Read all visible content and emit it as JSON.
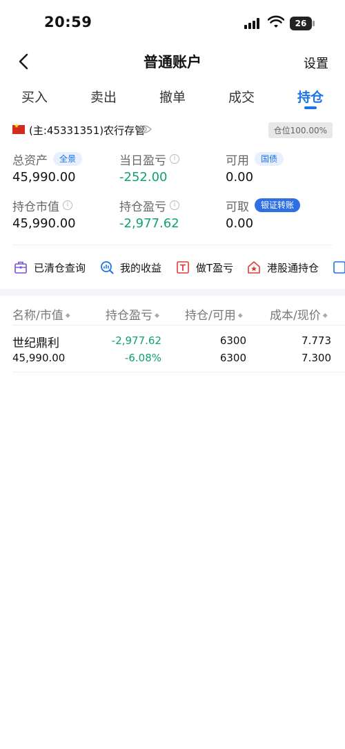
{
  "status_bar": {
    "time": "20:59",
    "battery": "26"
  },
  "nav": {
    "title": "普通账户",
    "settings": "设置"
  },
  "tabs": [
    {
      "label": "买入"
    },
    {
      "label": "卖出"
    },
    {
      "label": "撤单"
    },
    {
      "label": "成交"
    },
    {
      "label": "持仓",
      "active": true
    }
  ],
  "account": {
    "label": "(主:45331351)农行存管",
    "position_badge": "仓位100.00%"
  },
  "stats": {
    "total_assets": {
      "label": "总资产",
      "tag": "全景",
      "value": "45,990.00"
    },
    "daily_pnl": {
      "label": "当日盈亏",
      "value": "-252.00"
    },
    "available": {
      "label": "可用",
      "tag": "国债",
      "value": "0.00"
    },
    "market_value": {
      "label": "持仓市值",
      "value": "45,990.00"
    },
    "position_pnl": {
      "label": "持仓盈亏",
      "value": "-2,977.62"
    },
    "withdrawable": {
      "label": "可取",
      "tag": "银证转账",
      "value": "0.00"
    }
  },
  "tools": [
    {
      "label": "已清仓查询",
      "icon": "briefcase-icon"
    },
    {
      "label": "我的收益",
      "icon": "chart-search-icon"
    },
    {
      "label": "做T盈亏",
      "icon": "t-box-icon"
    },
    {
      "label": "港股通持仓",
      "icon": "house-star-icon"
    }
  ],
  "table": {
    "headers": [
      "名称/市值",
      "持仓盈亏",
      "持仓/可用",
      "成本/现价"
    ],
    "rows": [
      {
        "name": "世纪鼎利",
        "market_value": "45,990.00",
        "pnl": "-2,977.62",
        "pnl_pct": "-6.08%",
        "holding": "6300",
        "available": "6300",
        "cost": "7.773",
        "price": "7.300"
      }
    ]
  },
  "colors": {
    "accent": "#1a73e8",
    "loss_green": "#11a26a",
    "tool_purple": "#7a4fd6",
    "tool_blue": "#1a73e8",
    "tool_red": "#e03a3a"
  }
}
